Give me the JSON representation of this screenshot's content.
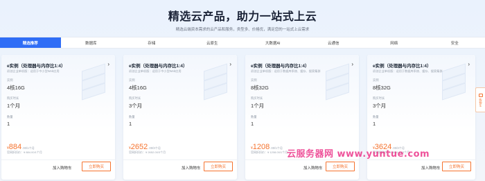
{
  "header": {
    "title": "精选云产品，助力一站式上云",
    "subtitle": "精选云端资本需求的云产品和服务，类型多、价格优，满足您的一站式上云需求"
  },
  "tabs": [
    {
      "label": "精选推荐",
      "active": true
    },
    {
      "label": "数据库",
      "active": false
    },
    {
      "label": "存储",
      "active": false
    },
    {
      "label": "云原生",
      "active": false
    },
    {
      "label": "大数据AI",
      "active": false
    },
    {
      "label": "云通信",
      "active": false
    },
    {
      "label": "网络",
      "active": false
    },
    {
      "label": "安全",
      "active": false
    }
  ],
  "cards": [
    {
      "title": "e实例（处理器与内存比1:4）",
      "desc": "初创企业单机版：适用于中小型Web应用",
      "spec_label": "实例",
      "spec": "4核16G",
      "duration_label": "购买时长",
      "duration": "1个月",
      "qty_label": "数量",
      "qty": "1",
      "currency": "¥",
      "price": "884",
      "price_suffix": ".00/1个月",
      "ref": "官网折扣价：¥ 884.00/1个月",
      "cart": "加入购物车",
      "buy": "立即购买"
    },
    {
      "title": "e实例（处理器与内存比1:4）",
      "desc": "初创企业单机版：适用于中小型Web应用",
      "spec_label": "实例",
      "spec": "4核16G",
      "duration_label": "购买时长",
      "duration": "3个月",
      "qty_label": "数量",
      "qty": "1",
      "currency": "¥",
      "price": "2652",
      "price_suffix": ".00/3个月",
      "ref": "官网折扣价：¥ 2652.00/3个月",
      "cart": "加入购物车",
      "buy": "立即购买"
    },
    {
      "title": "e实例（处理器与内存比1:4）",
      "desc": "初创企业单机版：适用于数据库系统、缓存、搜索集群",
      "spec_label": "实例",
      "spec": "8核32G",
      "duration_label": "购买时长",
      "duration": "1个月",
      "qty_label": "数量",
      "qty": "1",
      "currency": "¥",
      "price": "1208",
      "price_suffix": ".00/1个月",
      "ref": "官网折扣价：¥ 1208.00/1个月",
      "cart": "加入购物车",
      "buy": "立即购买"
    },
    {
      "title": "e实例（处理器与内存比1:4）",
      "desc": "初创企业单机版：适用于数据库系统、缓存、搜索集群",
      "spec_label": "实例",
      "spec": "8核32G",
      "duration_label": "购买时长",
      "duration": "3个月",
      "qty_label": "数量",
      "qty": "1",
      "currency": "¥",
      "price": "3624",
      "price_suffix": ".00/3个月",
      "ref": "官网折扣价：¥ 3624.00/3个月",
      "cart": "加入购物车",
      "buy": "立即购买"
    }
  ],
  "side_tab": {
    "label": "购物车",
    "icon": "cart-icon"
  },
  "watermark": "云服务器网 www.yuntue.com",
  "colors": {
    "accent": "#2f6df6",
    "price": "#f5722d",
    "watermark": "#e81878"
  }
}
